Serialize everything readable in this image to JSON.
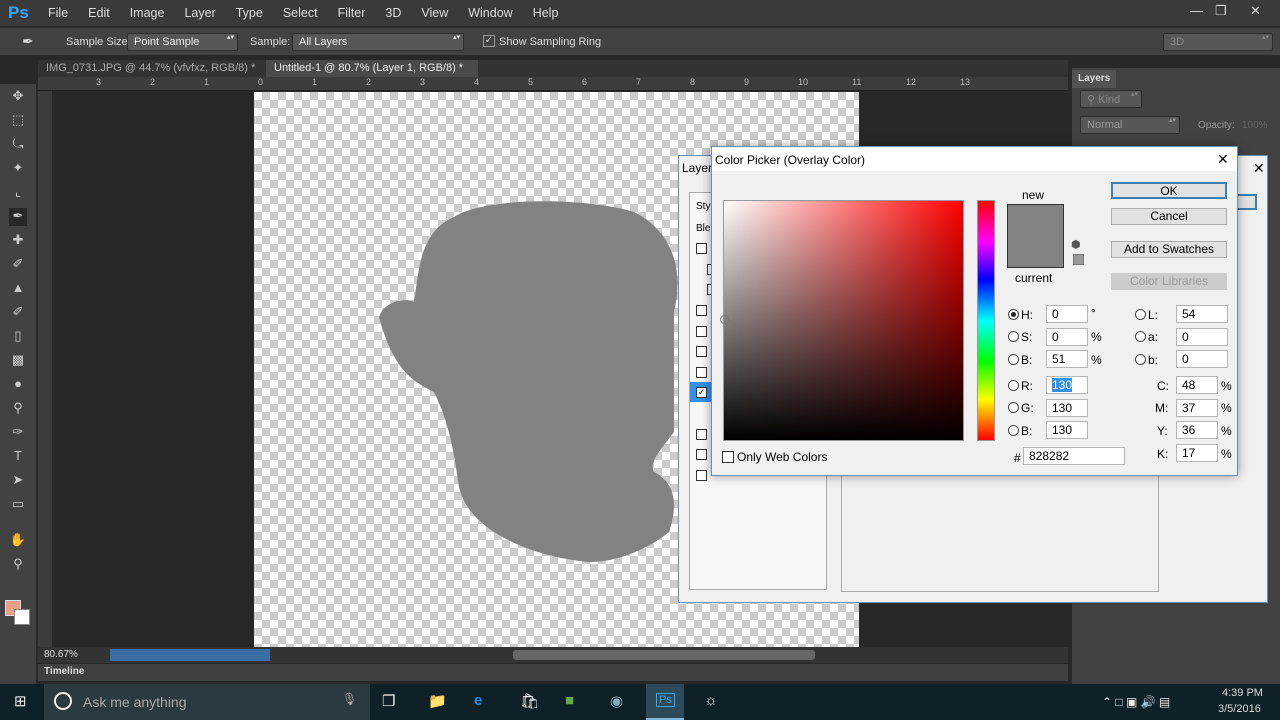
{
  "app": {
    "logo": "Ps",
    "menu": [
      "File",
      "Edit",
      "Image",
      "Layer",
      "Type",
      "Select",
      "Filter",
      "3D",
      "View",
      "Window",
      "Help"
    ]
  },
  "options": {
    "sample_size_label": "Sample Size:",
    "sample_size": "Point Sample",
    "sample_label": "Sample:",
    "sample": "All Layers",
    "show_ring": "Show Sampling Ring",
    "workspace": "3D"
  },
  "tabs": [
    {
      "label": "IMG_0731.JPG @ 44.7% (vfvfxz, RGB/8) *"
    },
    {
      "label": "Untitled-1 @ 80.7% (Layer 1, RGB/8) *"
    }
  ],
  "ruler": [
    "3",
    "2",
    "1",
    "0",
    "1",
    "2",
    "3",
    "4",
    "5",
    "6",
    "7",
    "8",
    "9",
    "10",
    "11",
    "12",
    "13"
  ],
  "status": {
    "zoom": "80.67%"
  },
  "timeline": {
    "label": "Timeline"
  },
  "layers_panel": {
    "title": "Layers",
    "kind": "Kind",
    "blend": "Normal",
    "opacity_label": "Opacity:",
    "opacity": "100%"
  },
  "layer_style": {
    "title": "Layer",
    "styles": "Styl",
    "blending": "Blen"
  },
  "picker": {
    "title": "Color Picker (Overlay Color)",
    "new": "new",
    "current": "current",
    "ok": "OK",
    "cancel": "Cancel",
    "add_swatches": "Add to Swatches",
    "libraries": "Color Libraries",
    "only_web": "Only Web Colors",
    "H": "0",
    "S": "0",
    "B": "51",
    "R": "130",
    "G": "130",
    "Bv": "130",
    "L": "54",
    "a": "0",
    "b": "0",
    "C": "48",
    "M": "37",
    "Y": "36",
    "K": "17",
    "hex": "828282",
    "deg": "°",
    "pct": "%",
    "hash": "#",
    "color": "#828282"
  },
  "taskbar": {
    "search": "Ask me anything",
    "time": "4:39 PM",
    "date": "3/5/2016"
  }
}
